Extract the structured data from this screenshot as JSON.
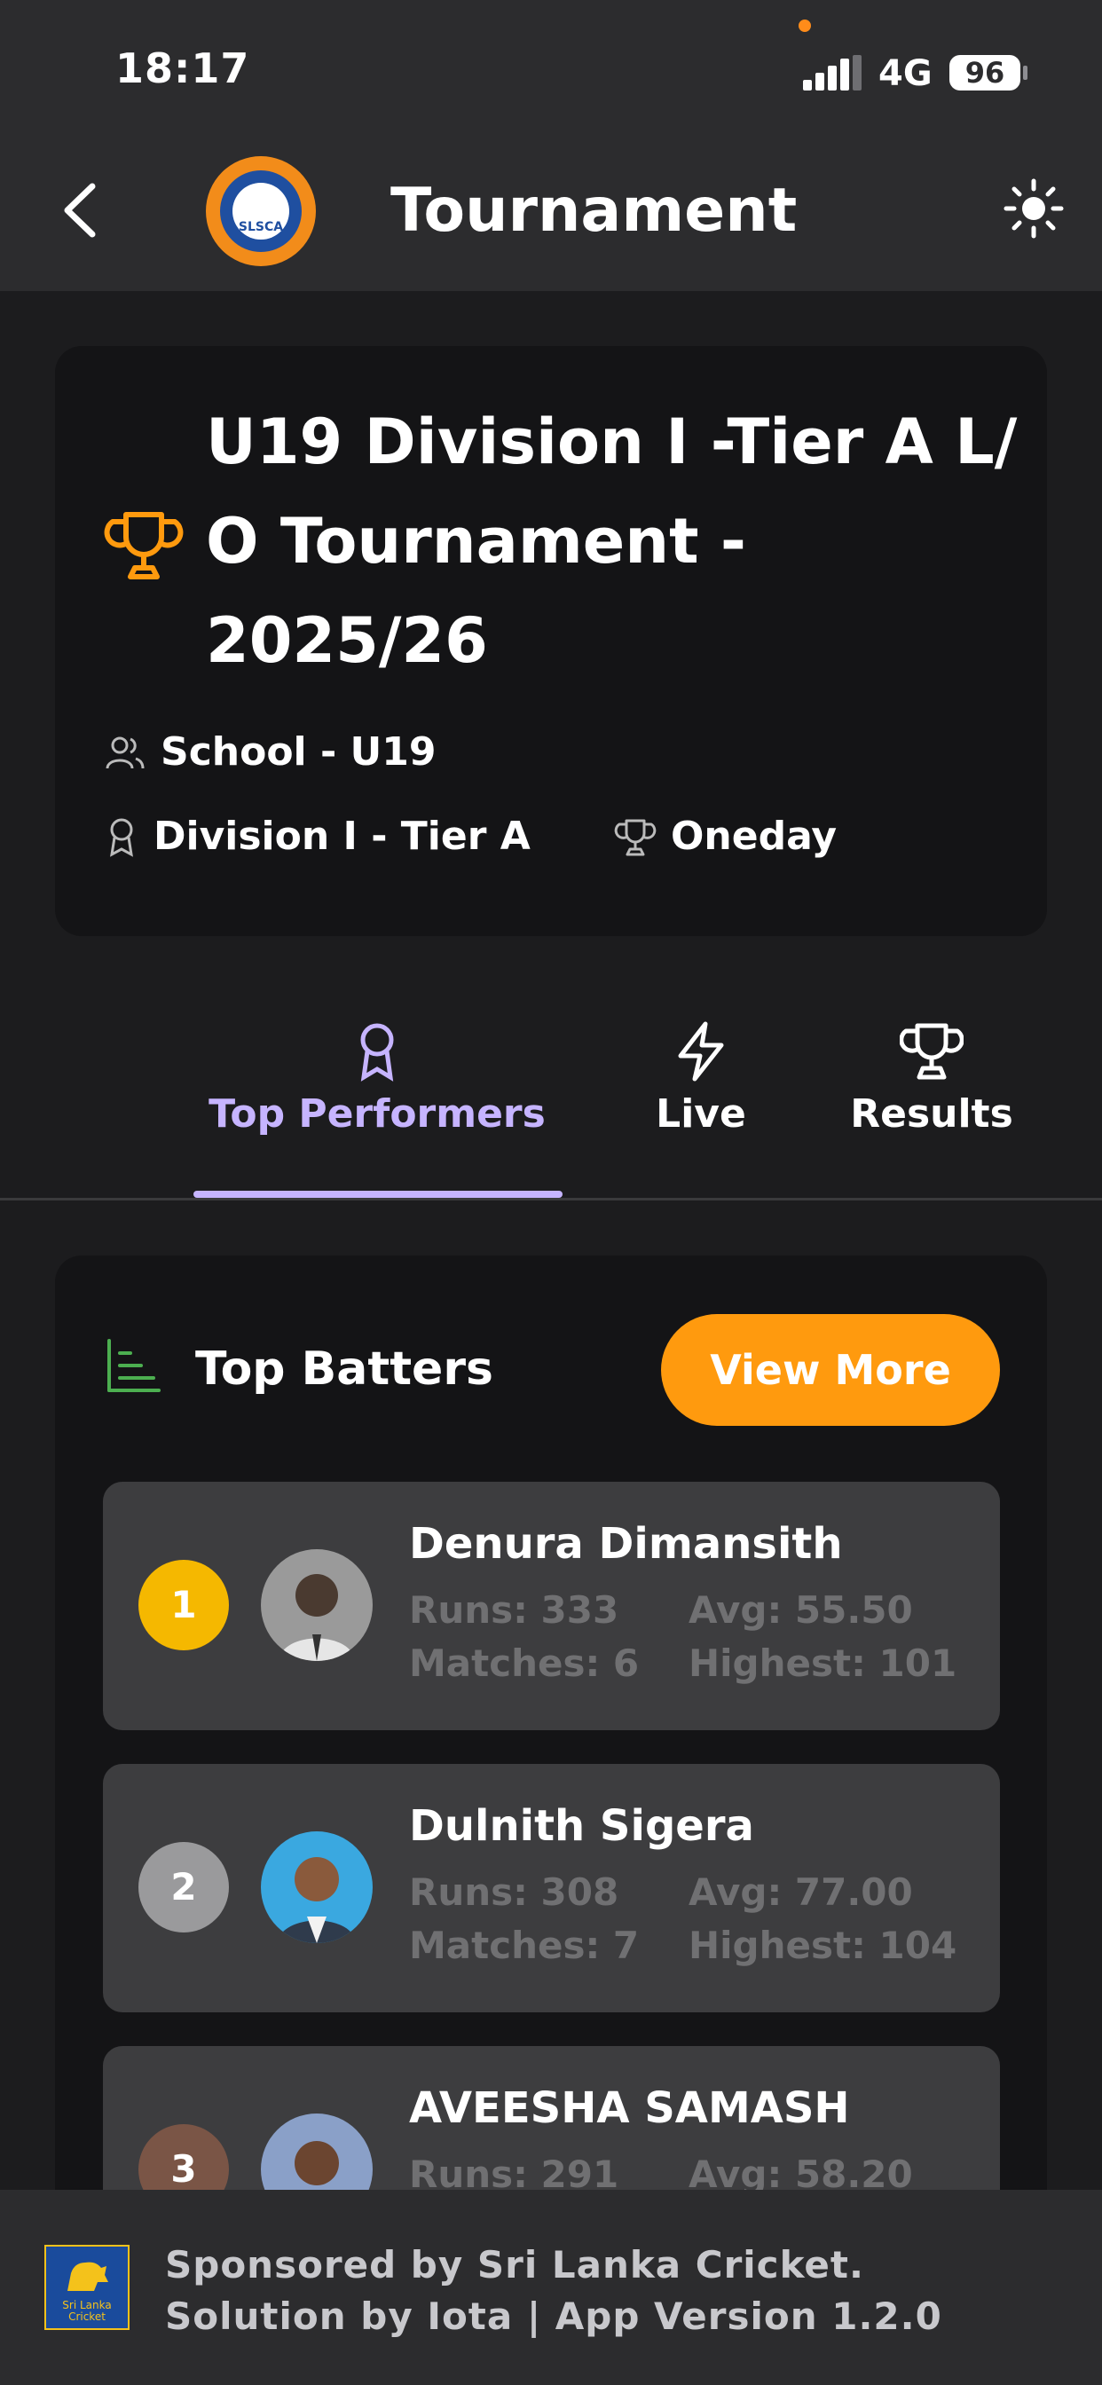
{
  "status_bar": {
    "time": "18:17",
    "network": "4G",
    "battery": "96"
  },
  "header": {
    "title": "Tournament",
    "icons": [
      "back-chevron-icon",
      "slsca-logo",
      "sun-icon"
    ]
  },
  "tournament": {
    "name": "U19 Division I -Tier A L/ O Tournament - 2025/26",
    "category": "School - U19",
    "division": "Division I - Tier A",
    "format": "Oneday"
  },
  "tabs": [
    {
      "label": "Top Performers",
      "icon": "award-icon",
      "active": true
    },
    {
      "label": "Live",
      "icon": "lightning-icon",
      "active": false
    },
    {
      "label": "Results",
      "icon": "trophy-icon",
      "active": false
    }
  ],
  "top_batters": {
    "title": "Top Batters",
    "view_more_label": "View More",
    "players": [
      {
        "rank": "1",
        "name": "Denura Dimansith",
        "runs": "Runs: 333",
        "avg": "Avg: 55.50",
        "matches": "Matches: 6",
        "highest": "Highest: 101"
      },
      {
        "rank": "2",
        "name": "Dulnith Sigera",
        "runs": "Runs: 308",
        "avg": "Avg: 77.00",
        "matches": "Matches: 7",
        "highest": "Highest: 104"
      },
      {
        "rank": "3",
        "name": "AVEESHA  SAMASH",
        "runs": "Runs: 291",
        "avg": "Avg: 58.20",
        "matches": "",
        "highest": ""
      }
    ]
  },
  "footer": {
    "line1": "Sponsored by Sri Lanka Cricket.",
    "line2": "Solution by Iota | App Version 1.2.0",
    "logo_text": "Sri Lanka Cricket"
  },
  "colors": {
    "accent": "#ff9a0e",
    "active_tab": "#c6b4ff",
    "rank1": "#f5b800",
    "rank2": "#9a9a9c",
    "rank3": "#7a5546",
    "chart_icon": "#4caf50"
  }
}
